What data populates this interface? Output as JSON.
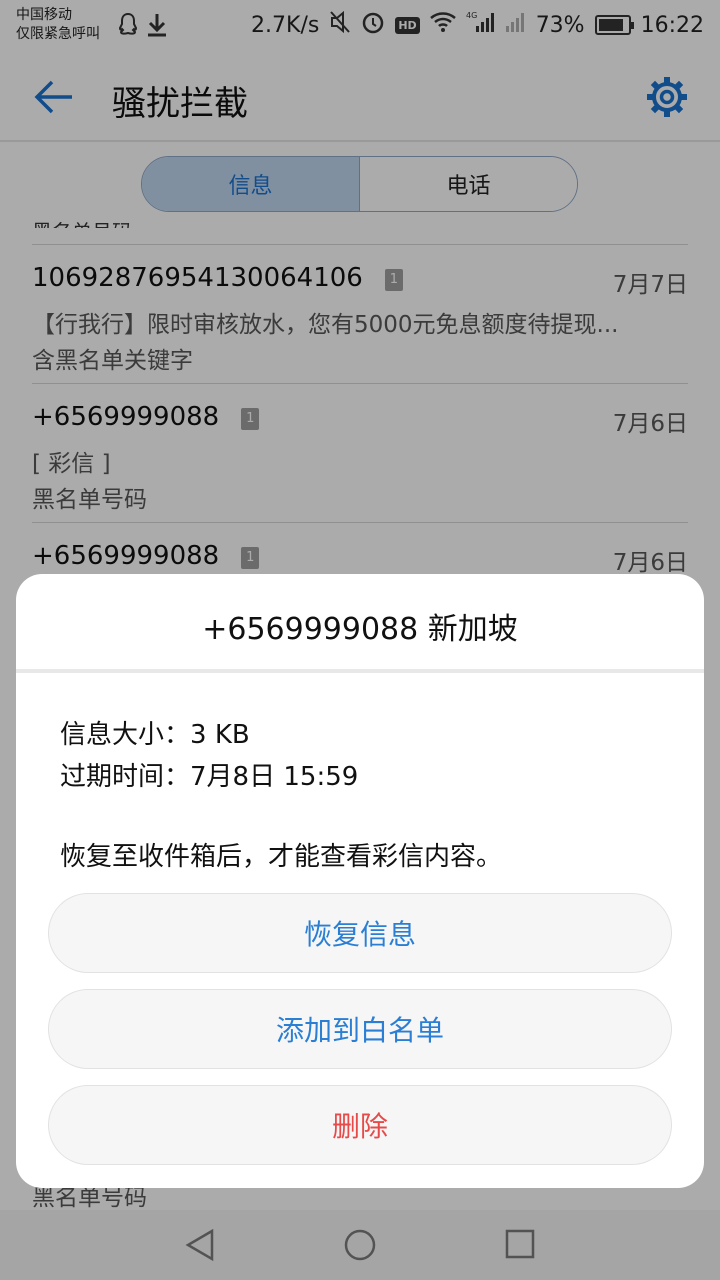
{
  "status_bar": {
    "carrier": "中国移动",
    "emergency": "仅限紧急呼叫",
    "net_speed": "2.7K/s",
    "hd": "HD",
    "network": "4G",
    "battery": "73%",
    "time": "16:22"
  },
  "app_bar": {
    "title": "骚扰拦截"
  },
  "tabs": {
    "messages": "信息",
    "calls": "电话"
  },
  "list": {
    "peek_text": "黑名单号码",
    "items": [
      {
        "sender": "1069287695413006 4106",
        "sender_full": "10692876954130064106",
        "sim": "1",
        "date": "7月7日",
        "preview": "【行我行】限时审核放水，您有5000元免息额度待提现...",
        "reason": "含黑名单关键字"
      },
      {
        "sender": "+6569999088",
        "sim": "1",
        "date": "7月6日",
        "preview": "[ 彩信 ]",
        "reason": "黑名单号码"
      },
      {
        "sender": "+6569999088",
        "sim": "1",
        "date": "7月6日"
      }
    ],
    "behind_text": "黑名单号码"
  },
  "dialog": {
    "title": "+6569999088 新加坡",
    "size_label": "信息大小：",
    "size_value": "3 KB",
    "expire_label": "过期时间：",
    "expire_value": "7月8日 15:59",
    "note": "恢复至收件箱后，才能查看彩信内容。",
    "restore": "恢复信息",
    "whitelist": "添加到白名单",
    "delete": "删除"
  },
  "colors": {
    "accent": "#1b6fc7",
    "danger": "#e84a4a"
  }
}
